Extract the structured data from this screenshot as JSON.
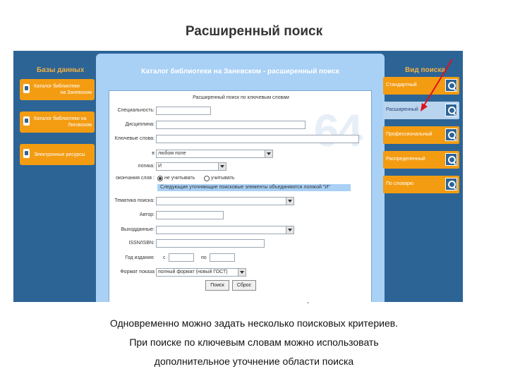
{
  "slide_title": "Расширенный поиск",
  "left_panel": {
    "title": "Базы данных",
    "items": [
      {
        "line1": "Каталог библиотеки",
        "line2": "на Заневском"
      },
      {
        "line1": "Каталог библиотеки на",
        "line2": "Лиговском"
      },
      {
        "line1": "Электронные ресурсы",
        "line2": ""
      }
    ]
  },
  "right_panel": {
    "title": "Вид поиска",
    "items": [
      "Стандартный",
      "Расширенный",
      "Профессиональный",
      "Распределенный",
      "По словарю"
    ]
  },
  "main": {
    "title": "Каталог библиотеки на Заневском - расширенный поиск",
    "form_heading": "Расширенный поиск по ключевым словам",
    "watermark": "64",
    "labels": {
      "specialty": "Специальность:",
      "discipline": "Дисциплина:",
      "keywords": "Ключевые слова:",
      "in": "в",
      "logic": "логика:",
      "endings": "окончания слов :",
      "theme": "Тематика поиска:",
      "author": "Автор:",
      "publisher": "Выходданные:",
      "isbn": "ISSN/ISBN:",
      "years": "Год издания:",
      "from": "с",
      "to": "по",
      "format": "Формат показа"
    },
    "values": {
      "in_select": "любом поле",
      "logic_select": "И",
      "endings_opt1": "не учитывать",
      "endings_opt2": "учитывать",
      "format_select": "полный формат (новый ГОСТ)"
    },
    "note": "Следующие уточняющие поисковые элементы объединяются логикой \"И\"",
    "buttons": {
      "search": "Поиск",
      "reset": "Сброс"
    }
  },
  "dash_mark": "-",
  "caption": [
    "Одновременно можно задать несколько поисковых критериев.",
    "При поиске по ключевым словам можно использовать",
    "дополнительное уточнение области поиска"
  ]
}
